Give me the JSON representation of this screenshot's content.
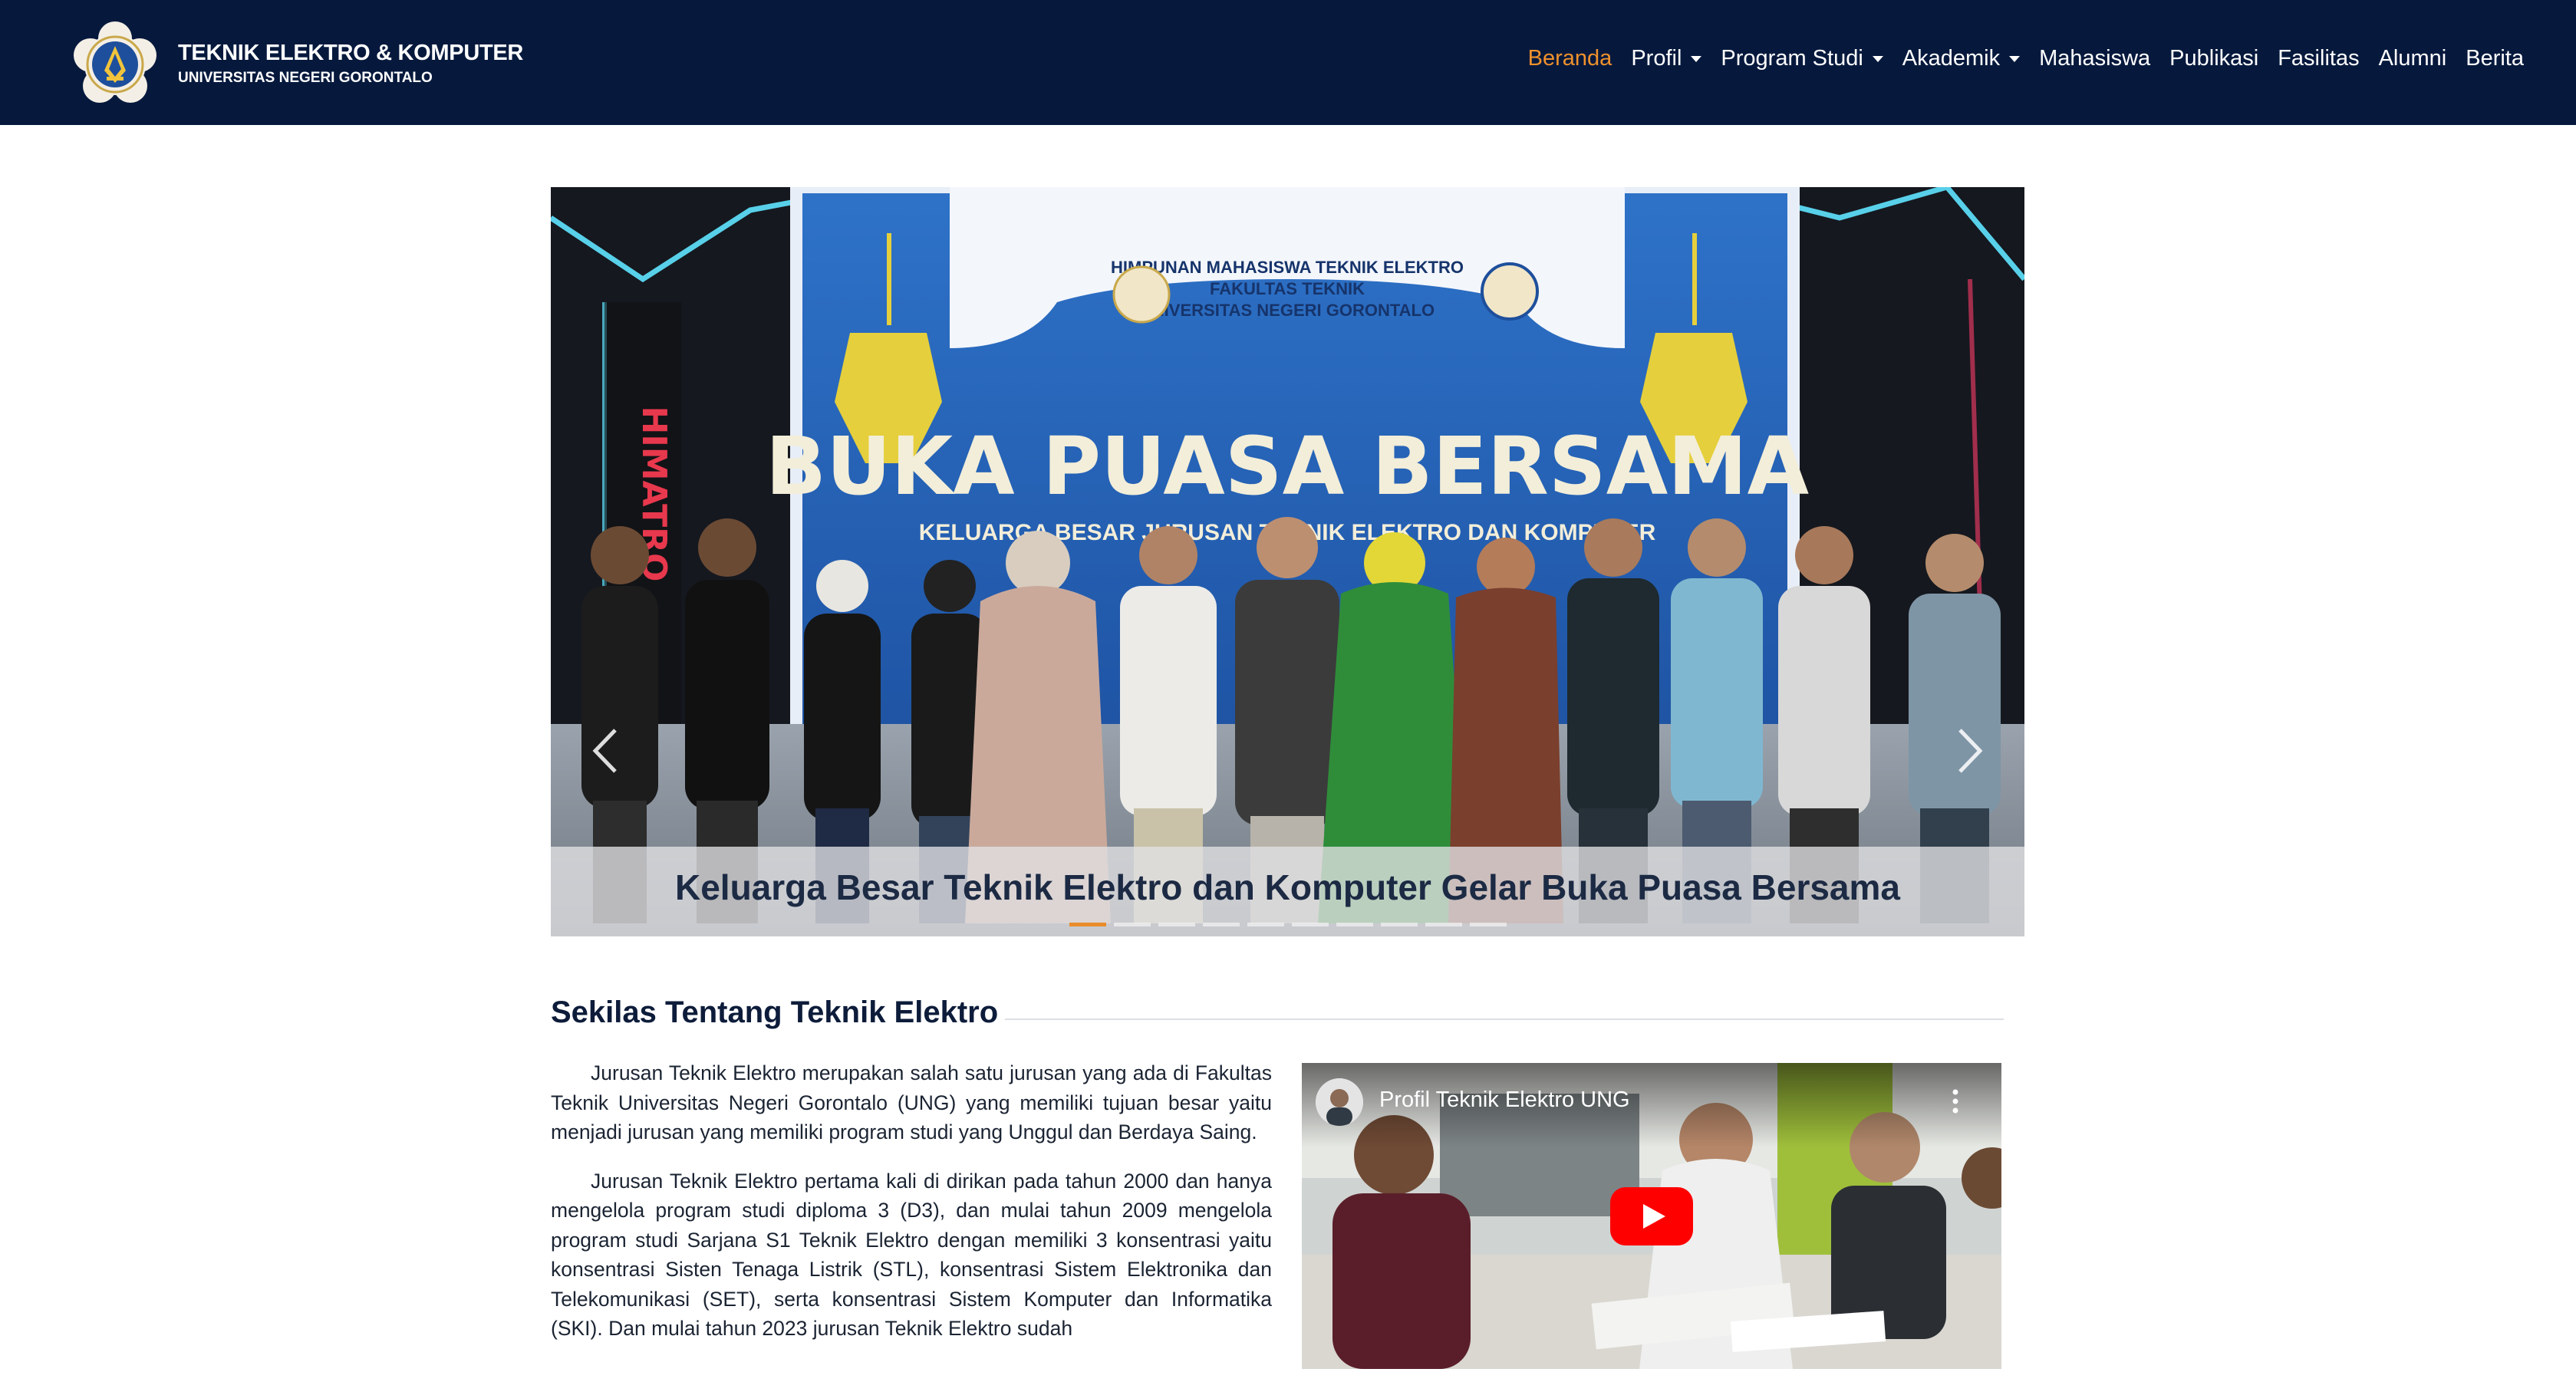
{
  "brand": {
    "title": "TEKNIK ELEKTRO & KOMPUTER",
    "subtitle": "UNIVERSITAS NEGERI GORONTALO",
    "logo_icon": "university-seal-logo"
  },
  "nav": {
    "items": [
      {
        "label": "Beranda",
        "active": true,
        "dropdown": false
      },
      {
        "label": "Profil",
        "active": false,
        "dropdown": true
      },
      {
        "label": "Program Studi",
        "active": false,
        "dropdown": true
      },
      {
        "label": "Akademik",
        "active": false,
        "dropdown": true
      },
      {
        "label": "Mahasiswa",
        "active": false,
        "dropdown": false
      },
      {
        "label": "Publikasi",
        "active": false,
        "dropdown": false
      },
      {
        "label": "Fasilitas",
        "active": false,
        "dropdown": false
      },
      {
        "label": "Alumni",
        "active": false,
        "dropdown": false
      },
      {
        "label": "Berita",
        "active": false,
        "dropdown": false
      }
    ]
  },
  "carousel": {
    "caption": "Keluarga Besar Teknik Elektro dan Komputer Gelar Buka Puasa Bersama",
    "banner": {
      "org_line1": "HIMPUNAN MAHASISWA TEKNIK ELEKTRO",
      "org_line2": "FAKULTAS TEKNIK",
      "org_line3": "UNIVERSITAS NEGERI GORONTALO",
      "headline": "BUKA PUASA BERSAMA",
      "subline": "KELUARGA BESAR JURUSAN TEKNIK ELEKTRO DAN KOMPUTER",
      "side_sign": "HIMATRO"
    },
    "indicator_count": 10,
    "active_indicator": 0,
    "prev_icon": "chevron-left-icon",
    "next_icon": "chevron-right-icon"
  },
  "about": {
    "title": "Sekilas Tentang Teknik Elektro",
    "paragraphs": [
      "Jurusan Teknik Elektro merupakan salah satu jurusan yang ada di Fakultas Teknik Universitas Negeri Gorontalo (UNG) yang memiliki tujuan besar yaitu menjadi jurusan yang memiliki program studi yang Unggul dan Berdaya Saing.",
      "Jurusan Teknik Elektro pertama kali di dirikan pada tahun 2000 dan hanya mengelola program studi diploma 3 (D3), dan mulai tahun 2009 mengelola program studi Sarjana S1 Teknik Elektro dengan memiliki 3 konsentrasi yaitu konsentrasi Sisten Tenaga Listrik (STL), konsentrasi Sistem Elektronika dan Telekomunikasi (SET), serta konsentrasi Sistem Komputer dan Informatika (SKI). Dan mulai tahun 2023 jurusan Teknik Elektro sudah"
    ]
  },
  "video": {
    "title": "Profil Teknik Elektro UNG",
    "play_icon": "youtube-play-icon",
    "menu_icon": "more-vertical-icon"
  },
  "colors": {
    "navbar_bg": "#06193d",
    "accent": "#f0912c",
    "heading": "#0d1c3a",
    "youtube_red": "#ff0000"
  }
}
